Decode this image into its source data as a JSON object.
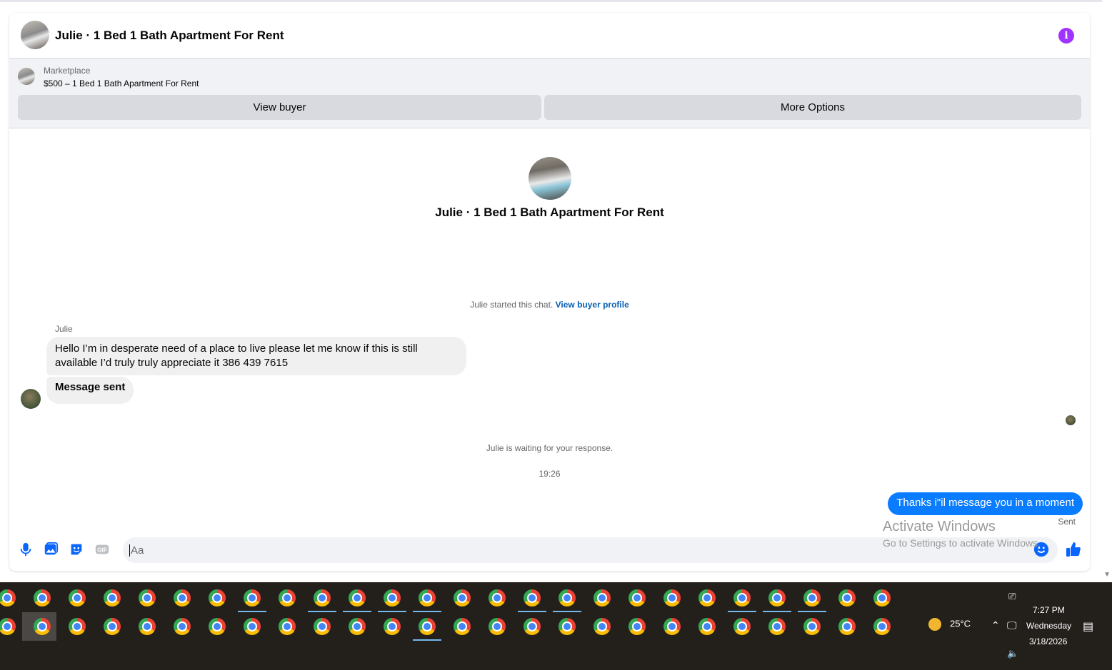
{
  "header": {
    "title": "Julie · 1 Bed 1 Bath Apartment For Rent"
  },
  "marketplace": {
    "label": "Marketplace",
    "item": "$500 – 1 Bed 1 Bath Apartment For Rent",
    "view_buyer_label": "View buyer",
    "more_options_label": "More Options"
  },
  "chat": {
    "intro_title": "Julie · 1 Bed 1 Bath Apartment For Rent",
    "started_text": "Julie started this chat.",
    "view_profile_link": "View buyer profile",
    "sender_name": "Julie",
    "incoming": [
      "Hello I’m in desperate need of a place to live please let me know if this is still available I’d truly truly appreciate it 386 439 7615",
      "Message sent"
    ],
    "waiting_text": "Julie is waiting for your response.",
    "timestamp": "19:26",
    "outgoing": "Thanks i\"il message you in a moment",
    "outgoing_status": "Sent"
  },
  "composer": {
    "placeholder": "Aa"
  },
  "watermark": {
    "line1": "Activate Windows",
    "line2": "Go to Settings to activate Windows."
  },
  "taskbar": {
    "temperature": "25°C",
    "time": "7:27 PM",
    "day": "Wednesday",
    "date": "3/18/2026"
  },
  "colors": {
    "accent_blue": "#0a7cff",
    "info_purple": "#a033ff",
    "icon_blue": "#0866ff"
  }
}
